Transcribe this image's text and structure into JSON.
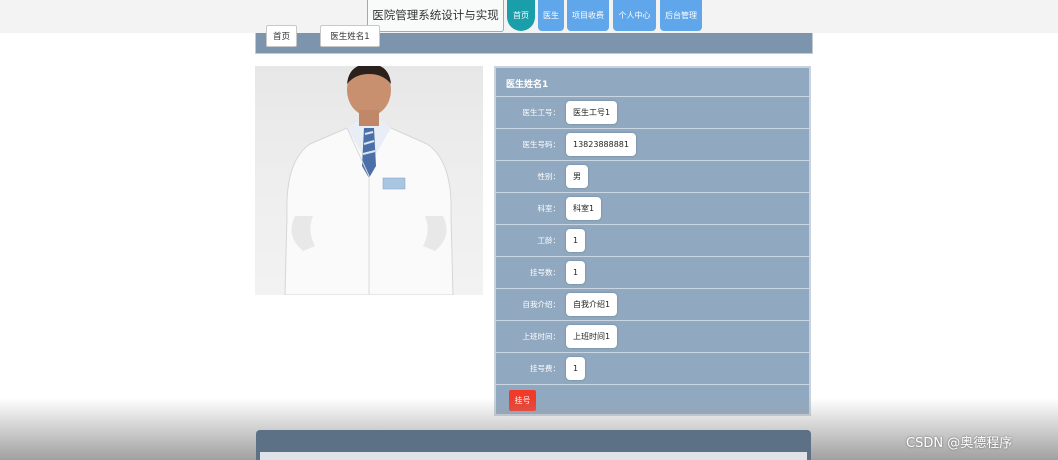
{
  "header": {
    "site_title": "医院管理系统设计与实现",
    "nav": [
      "首页",
      "医生",
      "项目收费",
      "个人中心",
      "后台管理"
    ]
  },
  "breadcrumb": {
    "home": "首页",
    "current": "医生姓名1"
  },
  "doctor": {
    "name": "医生姓名1",
    "fields": [
      {
        "label": "医生工号：",
        "value": "医生工号1"
      },
      {
        "label": "医生号码：",
        "value": "13823888881"
      },
      {
        "label": "性别：",
        "value": "男"
      },
      {
        "label": "科室：",
        "value": "科室1"
      },
      {
        "label": "工龄：",
        "value": "1"
      },
      {
        "label": "挂号数：",
        "value": "1"
      },
      {
        "label": "自我介绍：",
        "value": "自我介绍1"
      },
      {
        "label": "上班时间：",
        "value": "上班时间1"
      },
      {
        "label": "挂号费：",
        "value": "1"
      }
    ],
    "register_button": "挂号"
  },
  "watermark": "CSDN @奥德程序",
  "colors": {
    "accent": "#1a9ea9",
    "nav": "#60a6ea",
    "panel": "#91a9c0",
    "danger": "#f03a2a"
  }
}
